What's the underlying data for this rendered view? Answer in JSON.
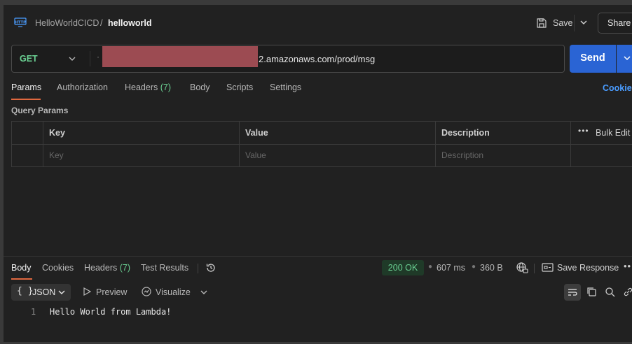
{
  "header": {
    "collection": "HelloWorldCICD",
    "separator": "/",
    "request_name": "helloworld",
    "save_label": "Save",
    "share_label": "Share"
  },
  "request": {
    "method": "GET",
    "url_prefix_dot": "·",
    "url_visible": "2.amazonaws.com/prod/msg",
    "send_label": "Send"
  },
  "request_tabs": [
    {
      "label": "Params",
      "count": ""
    },
    {
      "label": "Authorization",
      "count": ""
    },
    {
      "label": "Headers",
      "count": "(7)"
    },
    {
      "label": "Body",
      "count": ""
    },
    {
      "label": "Scripts",
      "count": ""
    },
    {
      "label": "Settings",
      "count": ""
    }
  ],
  "cookies_link": "Cookie",
  "query_params": {
    "title": "Query Params",
    "columns": [
      "Key",
      "Value",
      "Description"
    ],
    "bulk_edit": "Bulk Edit",
    "placeholders": {
      "key": "Key",
      "value": "Value",
      "description": "Description"
    }
  },
  "response": {
    "tabs": [
      {
        "label": "Body",
        "count": ""
      },
      {
        "label": "Cookies",
        "count": ""
      },
      {
        "label": "Headers",
        "count": "(7)"
      },
      {
        "label": "Test Results",
        "count": ""
      }
    ],
    "status": "200 OK",
    "time": "607 ms",
    "size": "360 B",
    "save_response": "Save Response",
    "format": "JSON",
    "format_braces": "{ }",
    "preview_label": "Preview",
    "visualize_label": "Visualize",
    "lines": [
      {
        "no": "1",
        "text": "Hello World from Lambda!"
      }
    ]
  },
  "colors": {
    "accent_send": "#2a64d4",
    "method_get": "#6bd193",
    "tab_underline": "#e0683f",
    "redaction": "#9c4b52",
    "status_ok_bg": "#1f3a28"
  }
}
